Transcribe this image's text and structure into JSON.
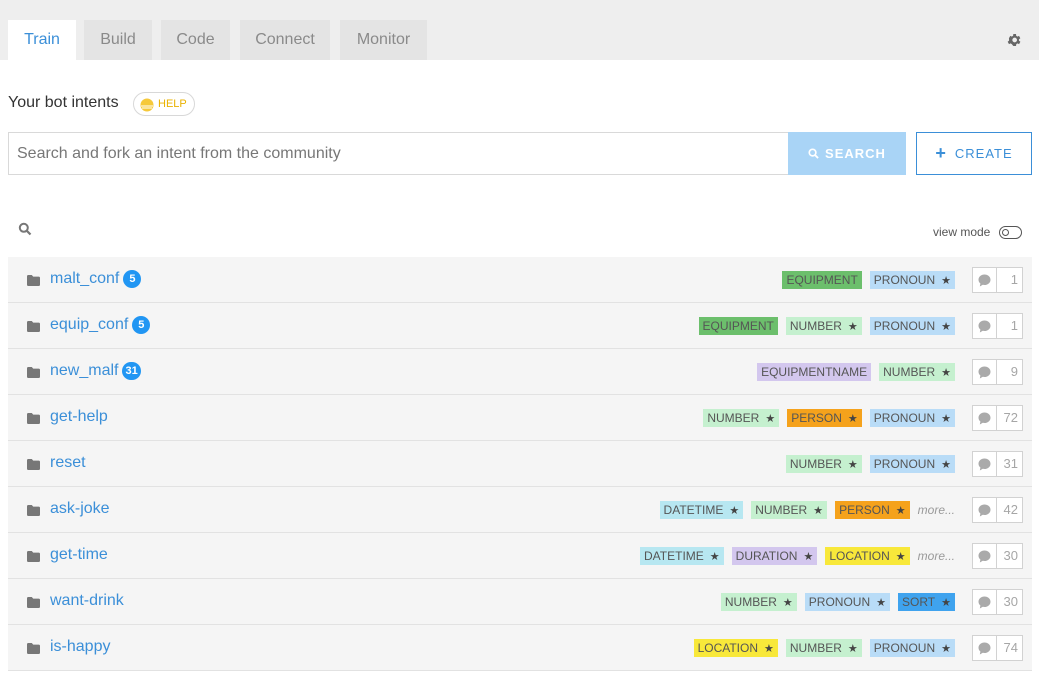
{
  "tabs": [
    {
      "label": "Train",
      "active": true
    },
    {
      "label": "Build",
      "active": false
    },
    {
      "label": "Code",
      "active": false
    },
    {
      "label": "Connect",
      "active": false
    },
    {
      "label": "Monitor",
      "active": false
    }
  ],
  "settings_icon": "gear-icon",
  "header": {
    "title": "Your bot intents",
    "help_label": "HELP"
  },
  "search": {
    "placeholder": "Search and fork an intent from the community",
    "value": "",
    "search_label": "SEARCH",
    "create_label": "CREATE"
  },
  "filter": {
    "view_mode_label": "view mode"
  },
  "colors": {
    "accent": "#3b8fd8",
    "badge": "#2196f3",
    "tag_equipment": "#6cbf6c",
    "tag_pronoun": "#b9dcf7",
    "tag_number": "#c5f0cf",
    "tag_equipmentname": "#d3c7ee",
    "tag_person": "#f5a21c",
    "tag_datetime": "#b7e7f1",
    "tag_duration": "#d3c7ee",
    "tag_location": "#f8e83a",
    "tag_sort": "#3fa3ee"
  },
  "intents": [
    {
      "name": "malt_conf",
      "badge": "5",
      "tags": [
        {
          "label": "EQUIPMENT",
          "color": "#6cbf6c",
          "star": false
        },
        {
          "label": "PRONOUN",
          "color": "#b9dcf7",
          "star": true
        }
      ],
      "more": "",
      "messages": "1"
    },
    {
      "name": "equip_conf",
      "badge": "5",
      "tags": [
        {
          "label": "EQUIPMENT",
          "color": "#6cbf6c",
          "star": false
        },
        {
          "label": "NUMBER",
          "color": "#c5f0cf",
          "star": true
        },
        {
          "label": "PRONOUN",
          "color": "#b9dcf7",
          "star": true
        }
      ],
      "more": "",
      "messages": "1"
    },
    {
      "name": "new_malf",
      "badge": "31",
      "tags": [
        {
          "label": "EQUIPMENTNAME",
          "color": "#d3c7ee",
          "star": false
        },
        {
          "label": "NUMBER",
          "color": "#c5f0cf",
          "star": true
        }
      ],
      "more": "",
      "messages": "9"
    },
    {
      "name": "get-help",
      "badge": "",
      "tags": [
        {
          "label": "NUMBER",
          "color": "#c5f0cf",
          "star": true
        },
        {
          "label": "PERSON",
          "color": "#f5a21c",
          "star": true
        },
        {
          "label": "PRONOUN",
          "color": "#b9dcf7",
          "star": true
        }
      ],
      "more": "",
      "messages": "72"
    },
    {
      "name": "reset",
      "badge": "",
      "tags": [
        {
          "label": "NUMBER",
          "color": "#c5f0cf",
          "star": true
        },
        {
          "label": "PRONOUN",
          "color": "#b9dcf7",
          "star": true
        }
      ],
      "more": "",
      "messages": "31"
    },
    {
      "name": "ask-joke",
      "badge": "",
      "tags": [
        {
          "label": "DATETIME",
          "color": "#b7e7f1",
          "star": true
        },
        {
          "label": "NUMBER",
          "color": "#c5f0cf",
          "star": true
        },
        {
          "label": "PERSON",
          "color": "#f5a21c",
          "star": true
        }
      ],
      "more": "more...",
      "messages": "42"
    },
    {
      "name": "get-time",
      "badge": "",
      "tags": [
        {
          "label": "DATETIME",
          "color": "#b7e7f1",
          "star": true
        },
        {
          "label": "DURATION",
          "color": "#d3c7ee",
          "star": true
        },
        {
          "label": "LOCATION",
          "color": "#f8e83a",
          "star": true
        }
      ],
      "more": "more...",
      "messages": "30"
    },
    {
      "name": "want-drink",
      "badge": "",
      "tags": [
        {
          "label": "NUMBER",
          "color": "#c5f0cf",
          "star": true
        },
        {
          "label": "PRONOUN",
          "color": "#b9dcf7",
          "star": true
        },
        {
          "label": "SORT",
          "color": "#3fa3ee",
          "star": true
        }
      ],
      "more": "",
      "messages": "30"
    },
    {
      "name": "is-happy",
      "badge": "",
      "tags": [
        {
          "label": "LOCATION",
          "color": "#f8e83a",
          "star": true
        },
        {
          "label": "NUMBER",
          "color": "#c5f0cf",
          "star": true
        },
        {
          "label": "PRONOUN",
          "color": "#b9dcf7",
          "star": true
        }
      ],
      "more": "",
      "messages": "74"
    }
  ]
}
